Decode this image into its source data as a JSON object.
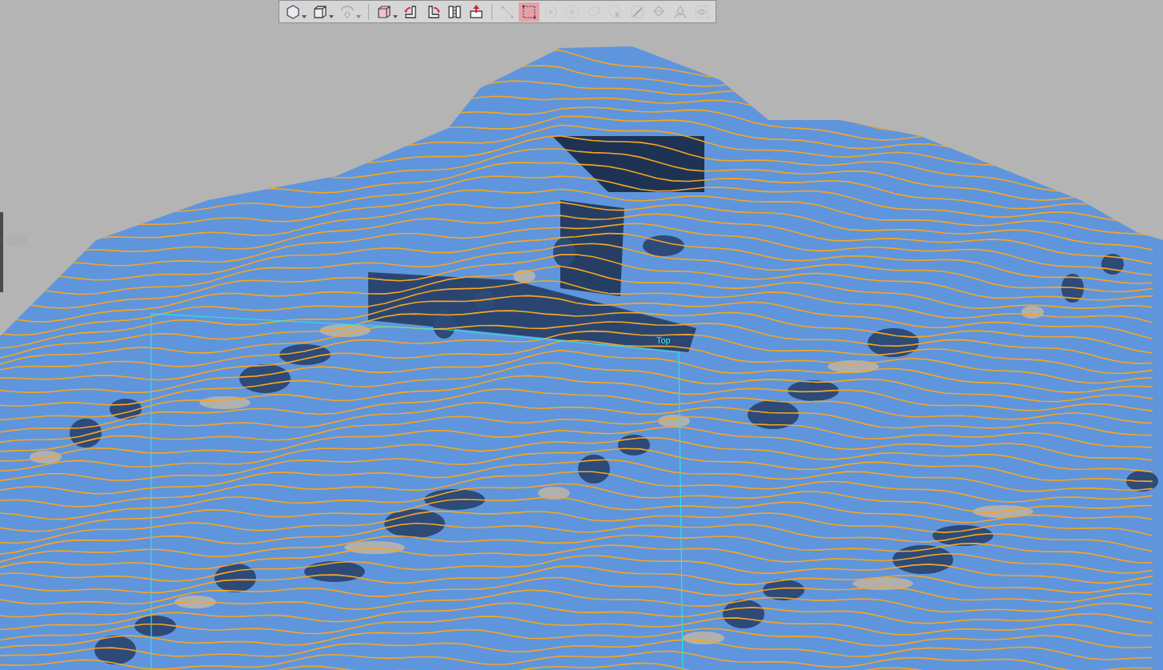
{
  "toolbar": {
    "groups": [
      [
        {
          "kind": "tool",
          "dropdown": true,
          "selected": false,
          "disabled": false
        },
        {
          "kind": "tool",
          "dropdown": true,
          "selected": false,
          "disabled": false
        },
        {
          "kind": "tool",
          "dropdown": true,
          "selected": false,
          "disabled": true
        }
      ],
      [
        {
          "kind": "tool",
          "dropdown": true,
          "selected": false,
          "disabled": false
        },
        {
          "kind": "tool",
          "dropdown": false,
          "selected": false,
          "disabled": false
        },
        {
          "kind": "tool",
          "dropdown": false,
          "selected": false,
          "disabled": false
        },
        {
          "kind": "tool",
          "dropdown": false,
          "selected": false,
          "disabled": false
        },
        {
          "kind": "tool",
          "dropdown": false,
          "selected": false,
          "disabled": false
        }
      ],
      [
        {
          "kind": "tool",
          "dropdown": false,
          "selected": false,
          "disabled": true
        },
        {
          "kind": "tool",
          "dropdown": false,
          "selected": true,
          "disabled": false
        },
        {
          "kind": "tool",
          "dropdown": false,
          "selected": false,
          "disabled": true
        },
        {
          "kind": "tool",
          "dropdown": false,
          "selected": false,
          "disabled": true
        },
        {
          "kind": "tool",
          "dropdown": false,
          "selected": false,
          "disabled": true
        },
        {
          "kind": "tool",
          "dropdown": false,
          "selected": false,
          "disabled": true
        },
        {
          "kind": "tool",
          "dropdown": false,
          "selected": false,
          "disabled": true
        },
        {
          "kind": "tool",
          "dropdown": false,
          "selected": false,
          "disabled": true
        },
        {
          "kind": "tool",
          "dropdown": false,
          "selected": false,
          "disabled": true
        },
        {
          "kind": "tool",
          "dropdown": false,
          "selected": false,
          "disabled": true
        }
      ]
    ]
  },
  "viewport": {
    "view_label": "Top"
  }
}
